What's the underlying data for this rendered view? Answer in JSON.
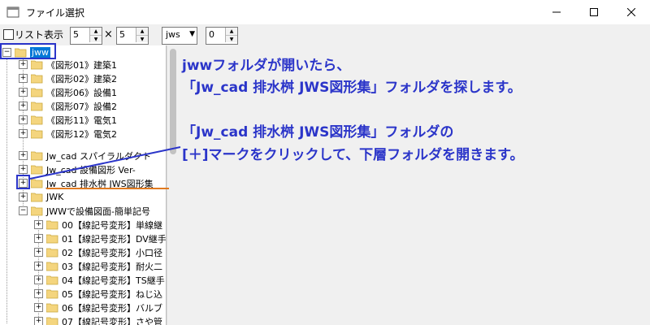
{
  "window": {
    "title": "ファイル選択"
  },
  "toolbar": {
    "list_label": "リスト表示",
    "cols": "5",
    "times": "×",
    "rows": "5",
    "filetype": "jws",
    "number": "0"
  },
  "tree": {
    "root": "jww",
    "items": [
      "《図形01》建築1",
      "《図形02》建築2",
      "《図形06》設備1",
      "《図形07》設備2",
      "《図形11》電気1",
      "《図形12》電気2",
      "Jw_cad スパイラルダクト",
      "Jw_cad 設備図形 Ver-",
      "Jw_cad 排水桝 JWS図形集",
      "JWK",
      "JWWで設備図面-簡単記号"
    ],
    "subitems": [
      "00【線記号変形】単線継",
      "01【線記号変形】DV継手",
      "02【線記号変形】小口径",
      "03【線記号変形】耐火二",
      "04【線記号変形】TS継手",
      "05【線記号変形】ねじ込",
      "06【線記号変形】バルブ",
      "07【線記号変形】さや管"
    ]
  },
  "instructions": {
    "line1": "jwwフォルダが開いたら、",
    "line2": "「Jw_cad 排水桝 JWS図形集」フォルダを探します。",
    "line3": "「Jw_cad 排水桝 JWS図形集」フォルダの",
    "line4": "[＋]マークをクリックして、下層フォルダを開きます。"
  },
  "colors": {
    "annotation": "#2b35c9",
    "underline": "#e07a20",
    "folder": "#f4d57e",
    "selection": "#0078d7"
  }
}
